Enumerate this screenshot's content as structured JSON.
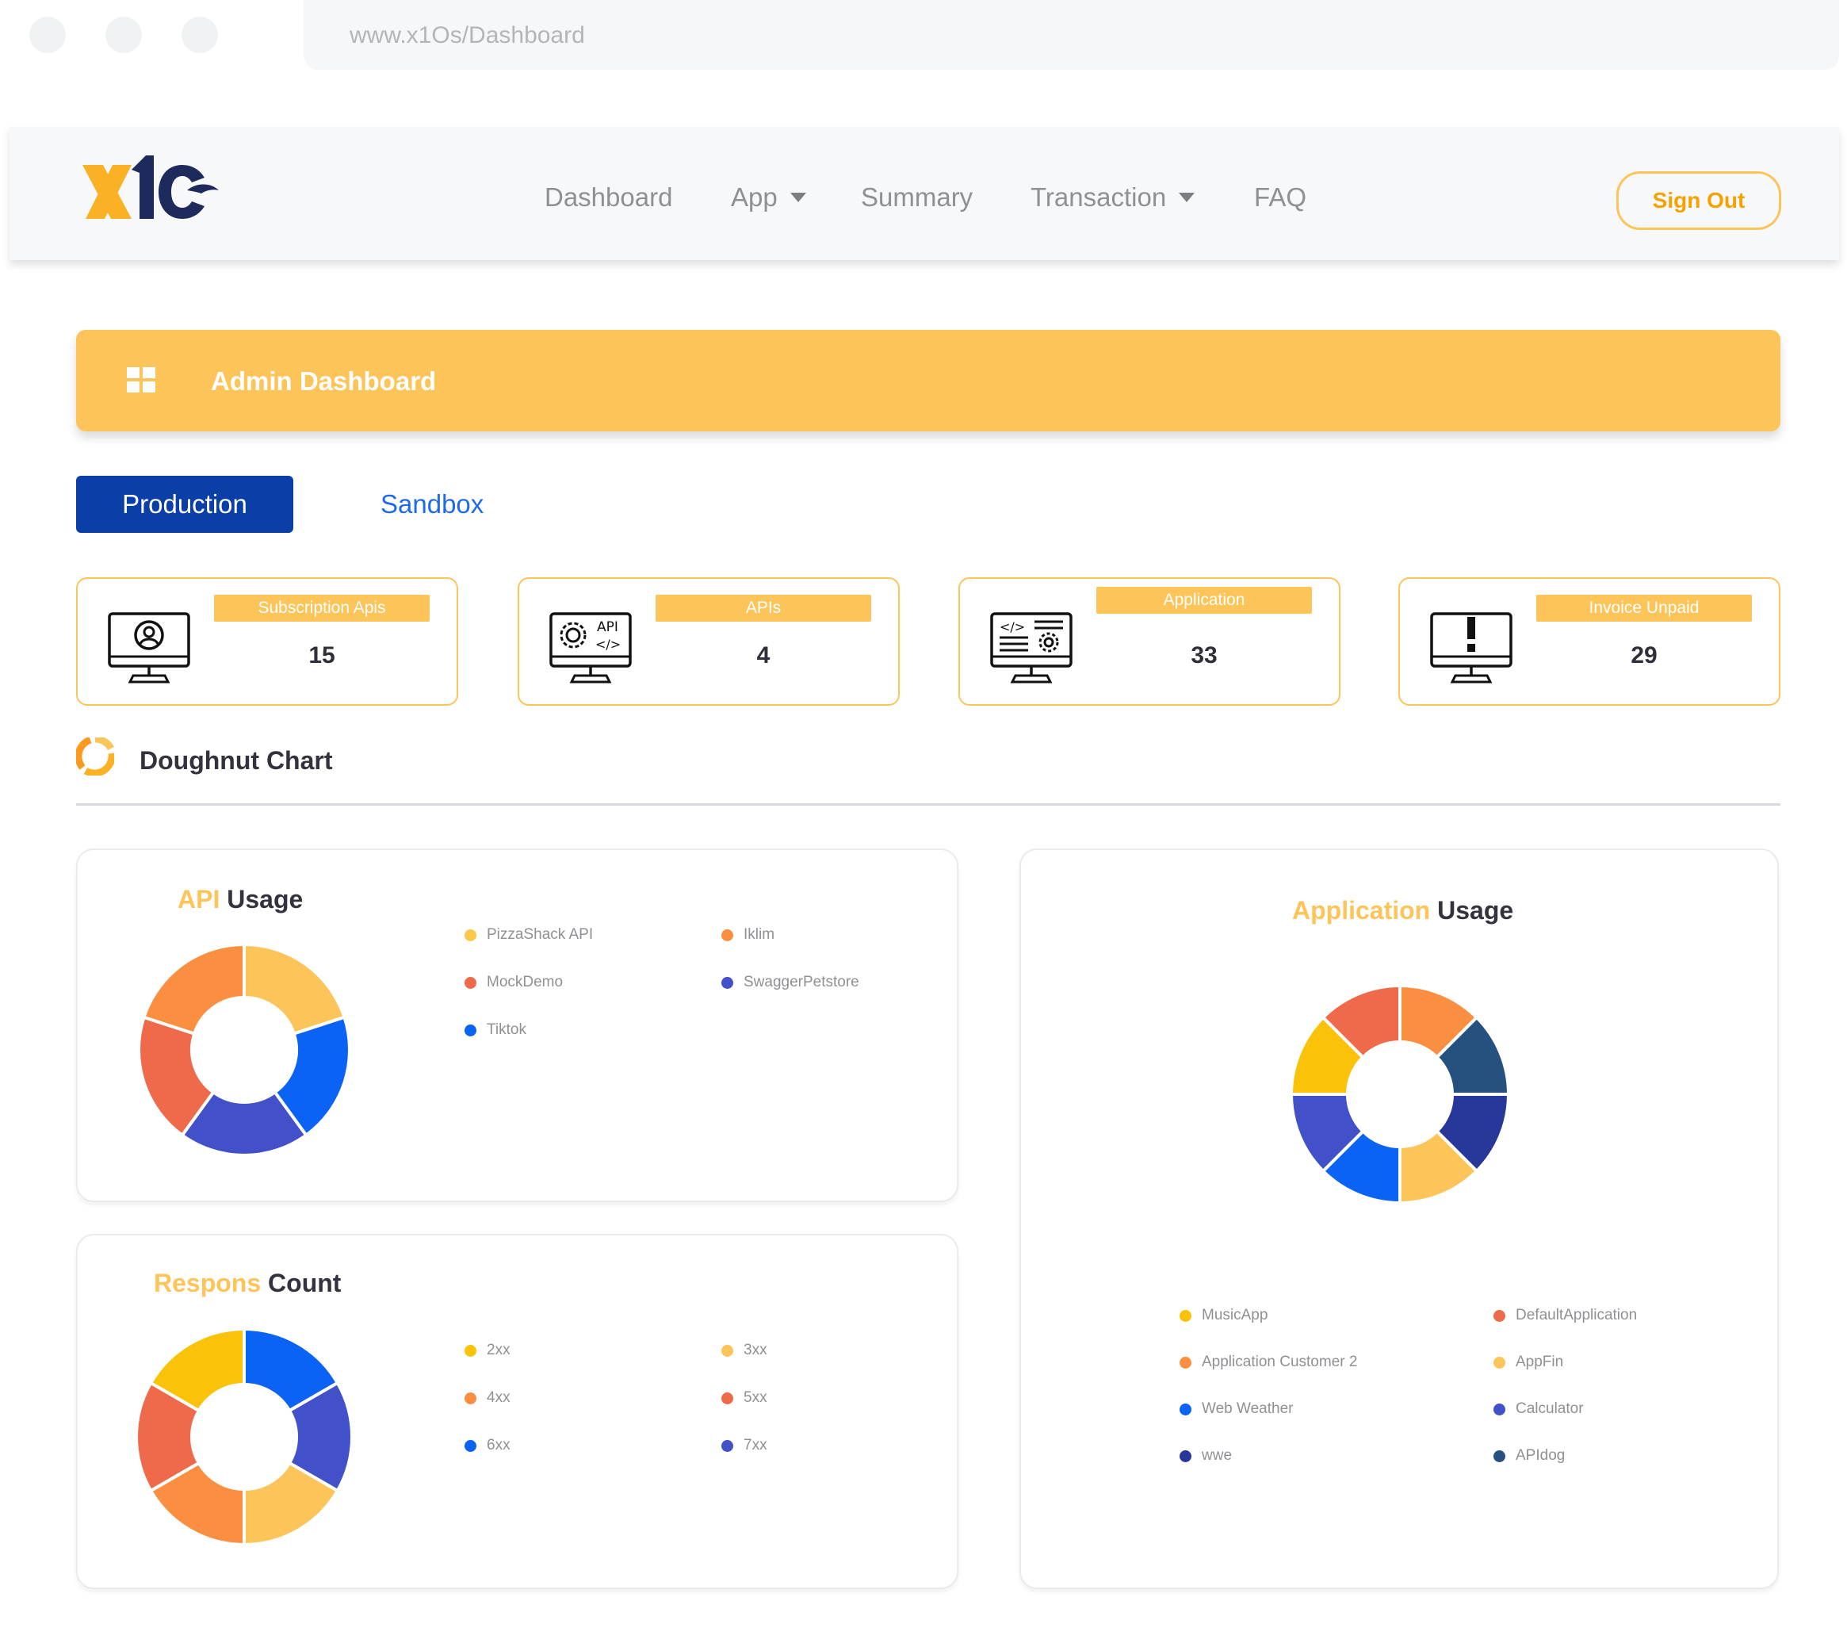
{
  "browser": {
    "url": "www.x1Os/Dashboard"
  },
  "nav": {
    "items": [
      {
        "label": "Dashboard",
        "dropdown": false
      },
      {
        "label": "App",
        "dropdown": true
      },
      {
        "label": "Summary",
        "dropdown": false
      },
      {
        "label": "Transaction",
        "dropdown": true
      },
      {
        "label": "FAQ",
        "dropdown": false
      }
    ],
    "sign_out": "Sign Out"
  },
  "banner": {
    "title": "Admin Dashboard",
    "icon": "grid-icon"
  },
  "tabs": {
    "production": "Production",
    "sandbox": "Sandbox",
    "active": "Production"
  },
  "stats": [
    {
      "label": "Subscription Apis",
      "value": "15",
      "icon": "user-monitor-icon"
    },
    {
      "label": "APIs",
      "value": "4",
      "icon": "api-monitor-icon"
    },
    {
      "label": "Application",
      "value": "33",
      "icon": "code-monitor-icon"
    },
    {
      "label": "Invoice Unpaid",
      "value": "29",
      "icon": "alert-monitor-icon"
    }
  ],
  "section": {
    "title": "Doughnut Chart",
    "icon": "doughnut-icon"
  },
  "colors": {
    "accent": "#fdc45a",
    "primary": "#0a3fa8",
    "link": "#1e6be6"
  },
  "chart_data": [
    {
      "type": "doughnut",
      "title_accent": "API",
      "title_rest": "Usage",
      "categories": [
        "PizzaShack API",
        "Iklim",
        "MockDemo",
        "SwaggerPetstore",
        "Tiktok"
      ],
      "legend": [
        {
          "name": "PizzaShack API",
          "color": "#fbc84b"
        },
        {
          "name": "Iklim",
          "color": "#fb8f41"
        },
        {
          "name": "MockDemo",
          "color": "#ee6a4a"
        },
        {
          "name": "SwaggerPetstore",
          "color": "#4250c9"
        },
        {
          "name": "Tiktok",
          "color": "#0a63f5"
        }
      ],
      "segments": [
        {
          "name": "PizzaShack API",
          "value": 20,
          "color": "#fdc45a"
        },
        {
          "name": "Tiktok",
          "value": 20,
          "color": "#0a63f5"
        },
        {
          "name": "SwaggerPetstore",
          "value": 20,
          "color": "#4250c9"
        },
        {
          "name": "MockDemo",
          "value": 20,
          "color": "#ee6a4a"
        },
        {
          "name": "Iklim",
          "value": 20,
          "color": "#fb8f41"
        }
      ]
    },
    {
      "type": "doughnut",
      "title_accent": "Respons",
      "title_rest": "Count",
      "categories": [
        "2xx",
        "3xx",
        "4xx",
        "5xx",
        "6xx",
        "7xx"
      ],
      "legend": [
        {
          "name": "2xx",
          "color": "#fbc20a"
        },
        {
          "name": "3xx",
          "color": "#fdc45a"
        },
        {
          "name": "4xx",
          "color": "#fb8f41"
        },
        {
          "name": "5xx",
          "color": "#ee6a4a"
        },
        {
          "name": "6xx",
          "color": "#0a63f5"
        },
        {
          "name": "7xx",
          "color": "#4250c9"
        }
      ],
      "segments": [
        {
          "name": "6xx",
          "value": 16.67,
          "color": "#0a63f5"
        },
        {
          "name": "7xx",
          "value": 16.67,
          "color": "#4250c9"
        },
        {
          "name": "3xx",
          "value": 16.67,
          "color": "#fdc45a"
        },
        {
          "name": "4xx",
          "value": 16.67,
          "color": "#fb8f41"
        },
        {
          "name": "5xx",
          "value": 16.67,
          "color": "#ee6a4a"
        },
        {
          "name": "2xx",
          "value": 16.67,
          "color": "#fbc20a"
        }
      ]
    },
    {
      "type": "doughnut",
      "title_accent": "Application",
      "title_rest": "Usage",
      "categories": [
        "MusicApp",
        "DefaultApplication",
        "Application  Customer 2",
        "AppFin",
        "Web Weather",
        "Calculator",
        "wwe",
        "APIdog"
      ],
      "legend": [
        {
          "name": "MusicApp",
          "color": "#fbc20a"
        },
        {
          "name": "DefaultApplication",
          "color": "#ee6a4a"
        },
        {
          "name": "Application  Customer 2",
          "color": "#fb8f41"
        },
        {
          "name": "AppFin",
          "color": "#fdc45a"
        },
        {
          "name": "Web Weather",
          "color": "#0a63f5"
        },
        {
          "name": "Calculator",
          "color": "#4250c9"
        },
        {
          "name": "wwe",
          "color": "#28389a"
        },
        {
          "name": "APIdog",
          "color": "#26507e"
        }
      ],
      "segments": [
        {
          "name": "Application  Customer 2",
          "value": 12.5,
          "color": "#fb8f41"
        },
        {
          "name": "APIdog",
          "value": 12.5,
          "color": "#26507e"
        },
        {
          "name": "wwe",
          "value": 12.5,
          "color": "#28389a"
        },
        {
          "name": "AppFin",
          "value": 12.5,
          "color": "#fdc45a"
        },
        {
          "name": "Web Weather",
          "value": 12.5,
          "color": "#0a63f5"
        },
        {
          "name": "Calculator",
          "value": 12.5,
          "color": "#4250c9"
        },
        {
          "name": "MusicApp",
          "value": 12.5,
          "color": "#fbc20a"
        },
        {
          "name": "DefaultApplication",
          "value": 12.5,
          "color": "#ee6a4a"
        }
      ]
    }
  ]
}
